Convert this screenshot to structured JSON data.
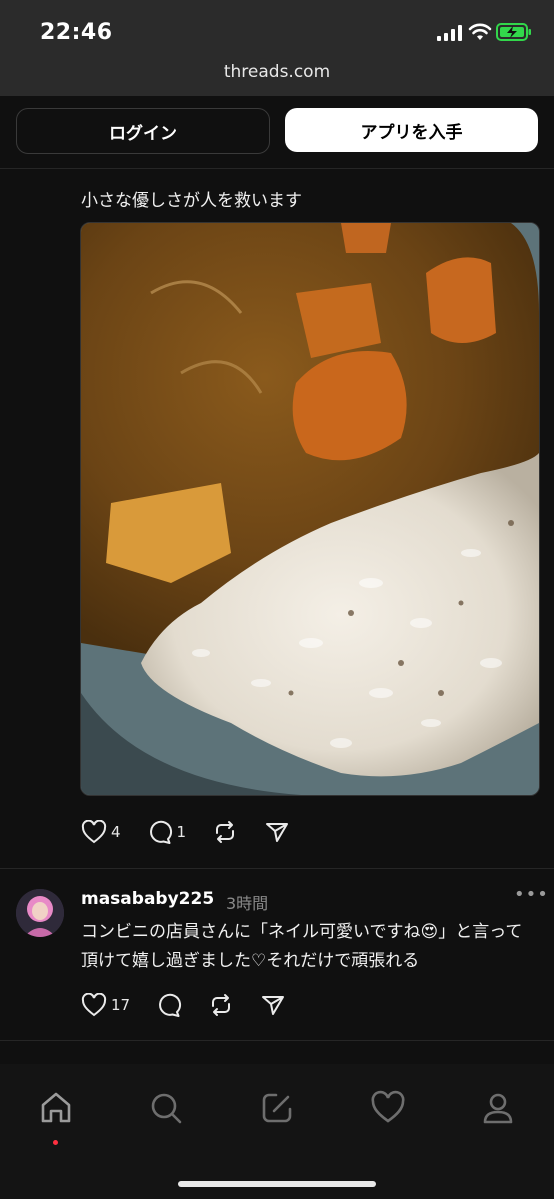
{
  "status_bar": {
    "time": "22:46",
    "battery_color": "#32d74b"
  },
  "browser": {
    "url": "threads.com"
  },
  "header": {
    "login_label": "ログイン",
    "get_app_label": "アプリを入手"
  },
  "post1": {
    "text": "小さな優しさが人を救います",
    "image": "curry-rice-photo",
    "likes": "4",
    "replies": "1"
  },
  "post2": {
    "username": "masababy225",
    "time": "3時間",
    "more_label": "•••",
    "text": "コンビニの店員さんに「ネイル可愛いですね😍」と言って頂けて嬉し過ぎました♡それだけで頑張れる",
    "likes": "17"
  },
  "nav": {
    "items": [
      "home-icon",
      "search-icon",
      "compose-icon",
      "heart-icon",
      "profile-icon"
    ],
    "notification_color": "#ff3040"
  }
}
